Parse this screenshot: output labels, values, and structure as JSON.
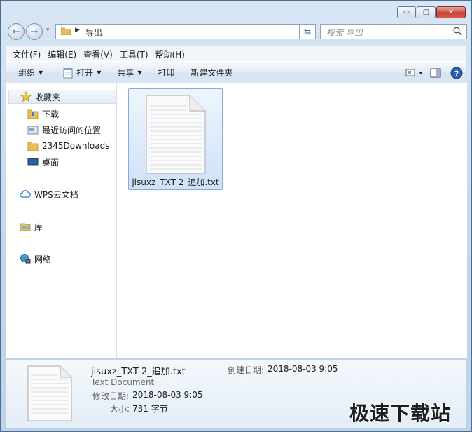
{
  "window": {
    "caption": {
      "minimize": "▭",
      "maximize": "▢",
      "close": "✕"
    }
  },
  "address": {
    "path": "导出",
    "search_placeholder": "搜索 导出"
  },
  "menu": [
    {
      "label": "文件(F)"
    },
    {
      "label": "编辑(E)"
    },
    {
      "label": "查看(V)"
    },
    {
      "label": "工具(T)"
    },
    {
      "label": "帮助(H)"
    }
  ],
  "toolbar": {
    "organize": "组织",
    "open": "打开",
    "share": "共享",
    "print": "打印",
    "new_folder": "新建文件夹"
  },
  "nav_pane": {
    "favorites": "收藏夹",
    "downloads": "下载",
    "recent": "最近访问的位置",
    "downloads2345": "2345Downloads",
    "desktop": "桌面",
    "wps": "WPS云文档",
    "libraries": "库",
    "network": "网络"
  },
  "files": [
    {
      "name": "jisuxz_TXT 2_追加.txt",
      "icon": "text-document-icon"
    }
  ],
  "details": {
    "name": "jisuxz_TXT 2_追加.txt",
    "type": "Text Document",
    "modified_label": "修改日期:",
    "modified_value": "2018-08-03 9:05",
    "size_label": "大小:",
    "size_value": "731 字节",
    "created_label": "创建日期:",
    "created_value": "2018-08-03 9:05"
  },
  "watermark": "极速下载站",
  "colors": {
    "accent": "#3a6aa5",
    "selection": "#cfe2f8"
  }
}
